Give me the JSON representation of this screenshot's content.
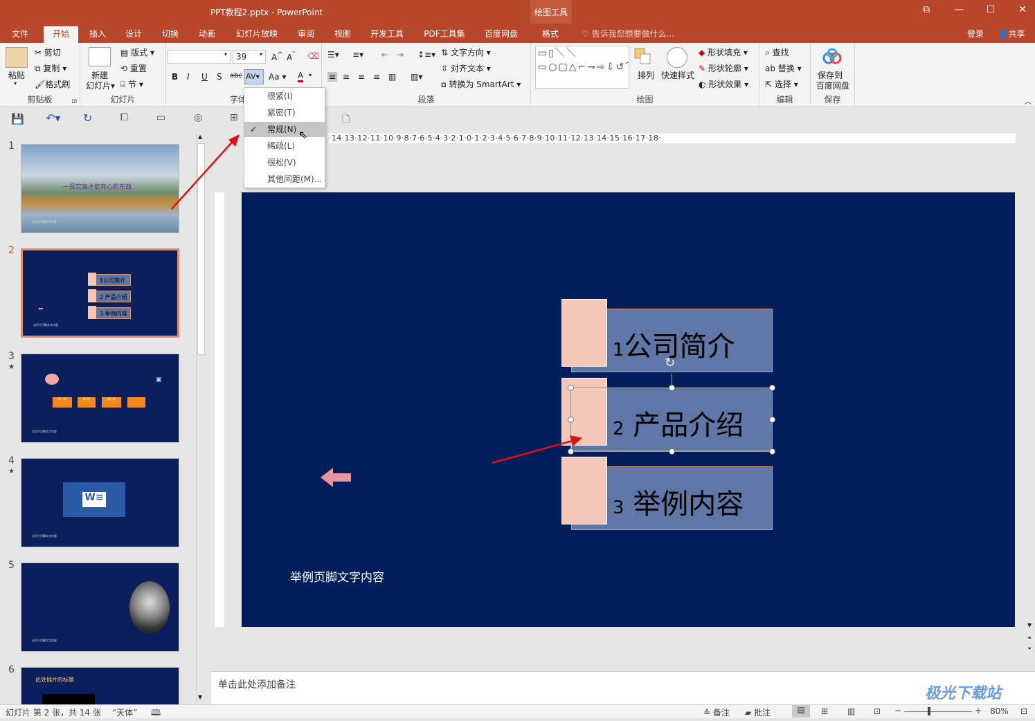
{
  "window": {
    "title": "PPT教程2.pptx - PowerPoint",
    "context_tools": "绘图工具"
  },
  "tabs": [
    {
      "label": "文件"
    },
    {
      "label": "开始"
    },
    {
      "label": "插入"
    },
    {
      "label": "设计"
    },
    {
      "label": "切换"
    },
    {
      "label": "动画"
    },
    {
      "label": "幻灯片放映"
    },
    {
      "label": "审阅"
    },
    {
      "label": "视图"
    },
    {
      "label": "开发工具"
    },
    {
      "label": "PDF工具集"
    },
    {
      "label": "百度网盘"
    },
    {
      "label": "格式"
    }
  ],
  "tellme": "告诉我您想要做什么...",
  "account": {
    "login": "登录",
    "share": "共享"
  },
  "ribbon": {
    "clipboard": {
      "paste": "粘贴",
      "cut": "剪切",
      "copy": "复制",
      "format_painter": "格式刷",
      "label": "剪贴板"
    },
    "slides": {
      "new_slide_1": "新建",
      "new_slide_2": "幻灯片",
      "layout": "版式",
      "reset": "重置",
      "section": "节",
      "label": "幻灯片"
    },
    "font": {
      "font_name": "",
      "font_size": "39",
      "label": "字体"
    },
    "paragraph": {
      "text_direction": "文字方向",
      "align_text": "对齐文本",
      "convert_smartart": "转换为 SmartArt",
      "label": "段落"
    },
    "drawing": {
      "arrange": "排列",
      "quick_styles": "快速样式",
      "shape_fill": "形状填充",
      "shape_outline": "形状轮廓",
      "shape_effects": "形状效果",
      "label": "绘图"
    },
    "editing": {
      "find": "查找",
      "replace": "替换",
      "select": "选择",
      "label": "编辑"
    },
    "save": {
      "save_to_1": "保存到",
      "save_to_2": "百度网盘",
      "label": "保存"
    }
  },
  "spacing_menu": {
    "items": [
      {
        "label": "很紧(I)"
      },
      {
        "label": "紧密(T)"
      },
      {
        "label": "常规(N)",
        "checked": true
      },
      {
        "label": "稀疏(L)"
      },
      {
        "label": "很松(V)"
      },
      {
        "label": "其他间距(M)..."
      }
    ]
  },
  "ruler": {
    "horizontal": "·14·13·12·11·10·9·8·7·6·5·4·3·2·1·0·1·2·3·4·5·6·7·8·9·10·11·12·13·14·15·16·17·18·"
  },
  "thumbnails": [
    {
      "num": "1",
      "title": "一探究竟才能有心的东西",
      "footer": "幻灯片页脚文字内容"
    },
    {
      "num": "2",
      "items": [
        "1公司简介",
        "2 产品介绍",
        "3 举例内容"
      ],
      "footer": "幻灯片页脚文字内容"
    },
    {
      "num": "3",
      "star": "★",
      "steps": [
        "第一步",
        "第二步",
        "第三步",
        ""
      ],
      "footer": "幻灯片页脚文字内容"
    },
    {
      "num": "4",
      "star": "★",
      "footer": "幻灯片页脚文字内容"
    },
    {
      "num": "5",
      "footer": "幻灯片页脚文字内容"
    },
    {
      "num": "6",
      "title": "此处插片的标题"
    }
  ],
  "slide": {
    "items": [
      {
        "num": "1",
        "text": "公司简介"
      },
      {
        "num": "2",
        "text": "产品介绍"
      },
      {
        "num": "3",
        "text": "举例内容"
      }
    ],
    "footer": "举例页脚文字内容"
  },
  "notes": {
    "placeholder": "单击此处添加备注"
  },
  "status": {
    "slide_info": "幻灯片 第 2 张，共 14 张",
    "theme": "“天体”",
    "notes": "备注",
    "comments": "批注",
    "zoom": "80%"
  },
  "watermark": "极光下载站",
  "colors": {
    "accent": "#b7472a",
    "slide_bg": "#011e5c",
    "box_fill": "#5f77a6",
    "square_fill": "#f4c7b8",
    "arrow": "#e8949c"
  }
}
